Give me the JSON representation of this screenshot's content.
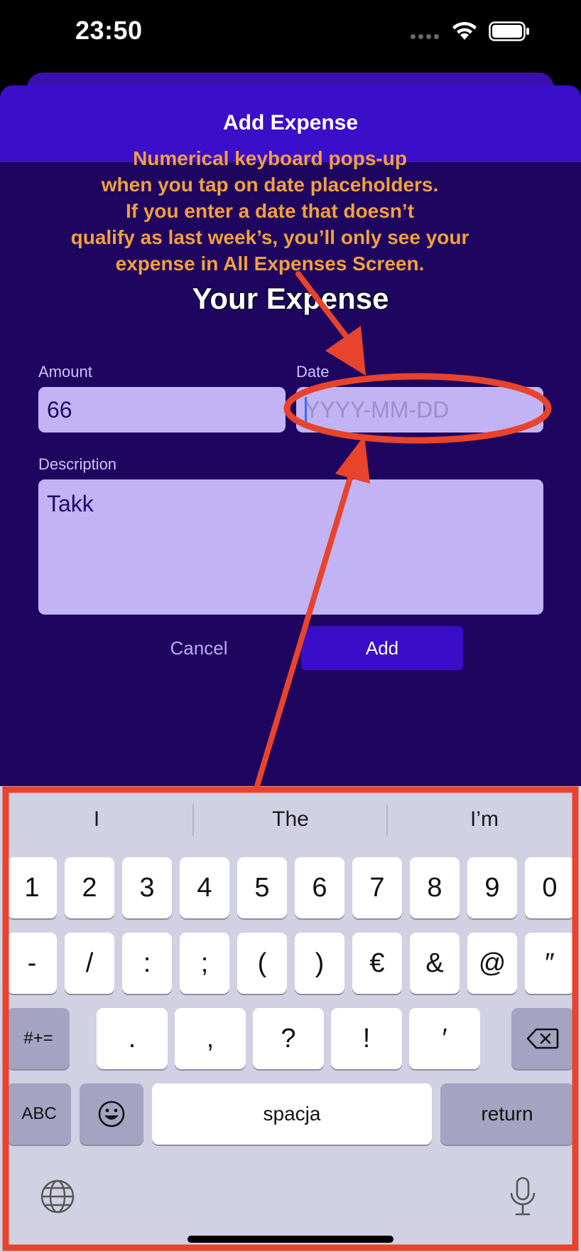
{
  "status_bar": {
    "time": "23:50"
  },
  "sheet": {
    "title": "Add Expense"
  },
  "annotation": {
    "lines": [
      "Numerical keyboard pops-up",
      "when you tap on date placeholders.",
      "If you enter a date that doesn’t",
      "qualify as last week’s, you’ll only see your",
      "expense in All Expenses Screen."
    ],
    "color": "#f2a03c"
  },
  "form": {
    "heading": "Your Expense",
    "amount": {
      "label": "Amount",
      "value": "66"
    },
    "date": {
      "label": "Date",
      "placeholder": "YYYY-MM-DD",
      "value": ""
    },
    "description": {
      "label": "Description",
      "value": "Takk"
    },
    "cancel_label": "Cancel",
    "add_label": "Add"
  },
  "keyboard": {
    "suggestions": [
      "I",
      "The",
      "I’m"
    ],
    "row1": [
      "1",
      "2",
      "3",
      "4",
      "5",
      "6",
      "7",
      "8",
      "9",
      "0"
    ],
    "row2": [
      "-",
      "/",
      ":",
      ";",
      "(",
      ")",
      "€",
      "&",
      "@",
      "″"
    ],
    "row3_switch": "#+=",
    "row3": [
      ".",
      ",",
      "?",
      "!",
      "′"
    ],
    "abc_label": "ABC",
    "space_label": "spacja",
    "return_label": "return",
    "icons": [
      "backspace-icon",
      "emoji-icon",
      "globe-icon",
      "microphone-icon"
    ]
  },
  "colors": {
    "sheet_background": "#1e0660",
    "header": "#3b0ec9",
    "field": "#c2b3f5",
    "add_button": "#3a0dc8",
    "highlight_red": "#e8432c"
  }
}
